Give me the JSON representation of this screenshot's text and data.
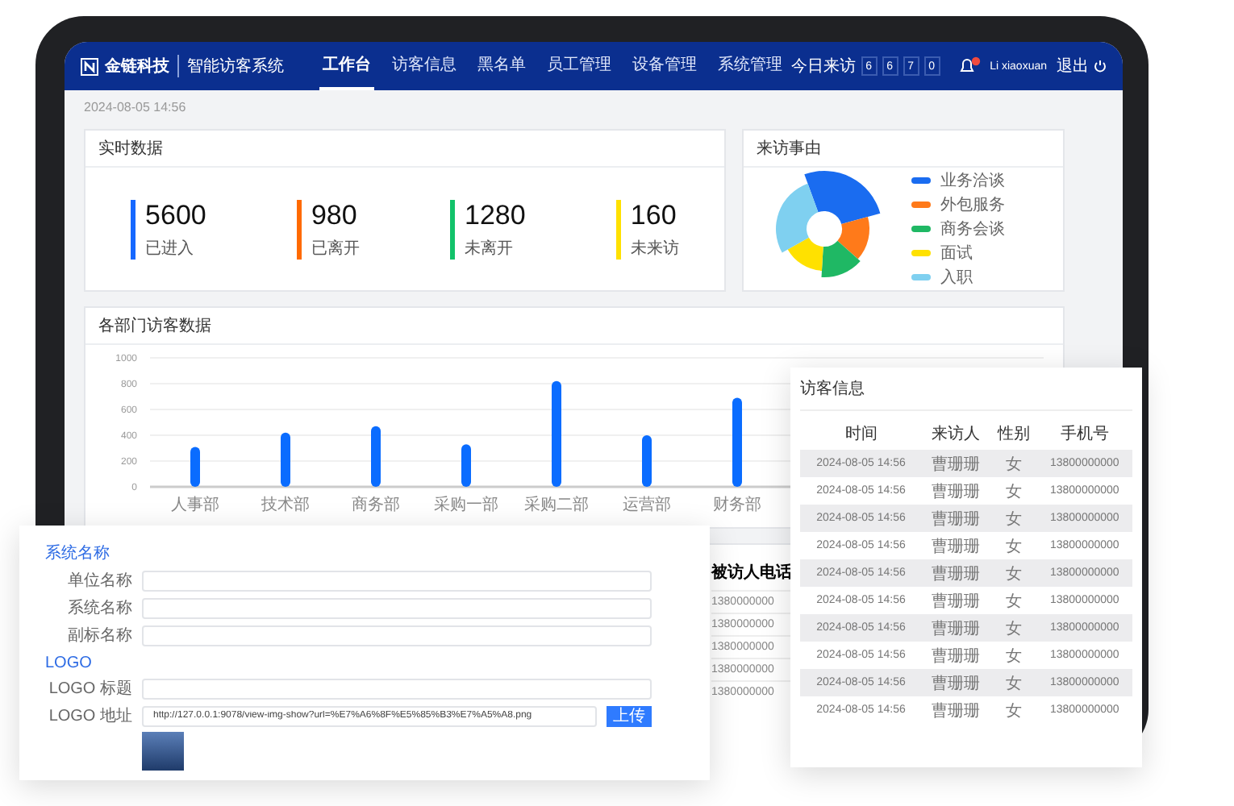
{
  "header": {
    "brand": "金链科技",
    "system": "智能访客系统",
    "nav": [
      {
        "label": "工作台",
        "selected": true
      },
      {
        "label": "访客信息",
        "selected": false
      },
      {
        "label": "黑名单",
        "selected": false
      },
      {
        "label": "员工管理",
        "selected": false
      },
      {
        "label": "设备管理",
        "selected": false
      },
      {
        "label": "系统管理",
        "selected": false
      }
    ],
    "visits_label": "今日来访",
    "visit_digits": [
      "6",
      "6",
      "7",
      "0"
    ],
    "user": "Li xiaoxuan",
    "logout": "退出"
  },
  "date": "2024-08-05 14:56",
  "realtime": {
    "title": "实时数据",
    "stats": [
      {
        "value": "5600",
        "label": "已进入",
        "color": "#1668ff"
      },
      {
        "value": "980",
        "label": "已离开",
        "color": "#ff6a00"
      },
      {
        "value": "1280",
        "label": "未离开",
        "color": "#12c26a"
      },
      {
        "value": "160",
        "label": "未来访",
        "color": "#ffe100"
      }
    ]
  },
  "reasons": {
    "title": "来访事由",
    "items": [
      {
        "label": "业务洽谈",
        "color": "#1a6cf0"
      },
      {
        "label": "外包服务",
        "color": "#ff7a1a"
      },
      {
        "label": "商务会谈",
        "color": "#1fb864"
      },
      {
        "label": "面试",
        "color": "#ffe100"
      },
      {
        "label": "入职",
        "color": "#7fd0f0"
      }
    ]
  },
  "departments": {
    "title": "各部门访客数据",
    "chart_data": {
      "type": "bar",
      "categories": [
        "人事部",
        "技术部",
        "商务部",
        "采购一部",
        "采购二部",
        "运营部",
        "财务部"
      ],
      "values": [
        310,
        420,
        470,
        330,
        820,
        400,
        690
      ],
      "ylim": [
        0,
        1000
      ],
      "grid": true,
      "yticks": [
        0,
        200,
        400,
        600,
        800,
        1000
      ]
    }
  },
  "record_table": {
    "columns": [
      "被访人电话"
    ],
    "rows": [
      "1380000000",
      "1380000000",
      "1380000000",
      "1380000000",
      "1380000000"
    ]
  },
  "settings_form": {
    "sections": [
      {
        "title": "系统名称",
        "fields": [
          {
            "kind": "text",
            "label": "单位名称"
          },
          {
            "kind": "text",
            "label": "系统名称"
          },
          {
            "kind": "text",
            "label": "副标名称"
          }
        ]
      },
      {
        "title": "LOGO",
        "fields": [
          {
            "kind": "text",
            "label": "LOGO 标题"
          },
          {
            "kind": "upload",
            "label": "LOGO 地址",
            "value": "http://127.0.0.1:9078/view-img-show?url=%E7%A6%8F%E5%85%B3%E7%A5%A8.png",
            "button": "上传",
            "preview": true
          }
        ]
      }
    ]
  },
  "visitor_table": {
    "title": "访客信息",
    "columns": [
      "时间",
      "来访人",
      "性别",
      "手机号"
    ],
    "rows": [
      [
        "2024-08-05 14:56",
        "曹珊珊",
        "女",
        "13800000000"
      ],
      [
        "2024-08-05 14:56",
        "曹珊珊",
        "女",
        "13800000000"
      ],
      [
        "2024-08-05 14:56",
        "曹珊珊",
        "女",
        "13800000000"
      ],
      [
        "2024-08-05 14:56",
        "曹珊珊",
        "女",
        "13800000000"
      ],
      [
        "2024-08-05 14:56",
        "曹珊珊",
        "女",
        "13800000000"
      ],
      [
        "2024-08-05 14:56",
        "曹珊珊",
        "女",
        "13800000000"
      ],
      [
        "2024-08-05 14:56",
        "曹珊珊",
        "女",
        "13800000000"
      ],
      [
        "2024-08-05 14:56",
        "曹珊珊",
        "女",
        "13800000000"
      ],
      [
        "2024-08-05 14:56",
        "曹珊珊",
        "女",
        "13800000000"
      ],
      [
        "2024-08-05 14:56",
        "曹珊珊",
        "女",
        "13800000000"
      ]
    ]
  }
}
